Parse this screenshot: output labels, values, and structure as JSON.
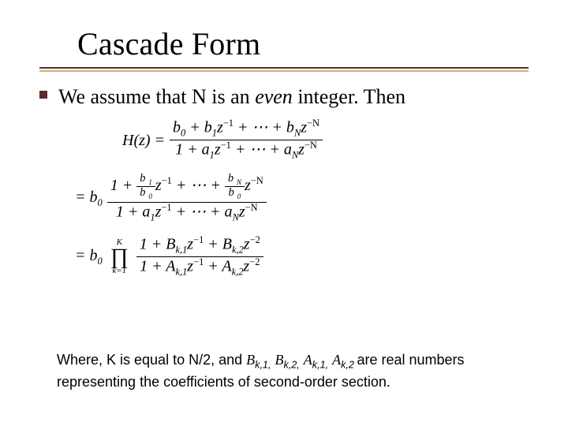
{
  "title": "Cascade Form",
  "lead": {
    "prefix": "We assume that N is an ",
    "even": "even",
    "suffix": " integer. Then"
  },
  "eq1": {
    "lhs": "H(z) =",
    "num": {
      "t0": "b",
      "s0": "0",
      "plus1": " + b",
      "s1": "1",
      "z1": "z",
      "e1": "−1",
      "plus2": " + ⋯ + b",
      "sN": "N",
      "zN": "z",
      "eN": "−N"
    },
    "den": {
      "one": "1 + a",
      "s1": "1",
      "z1": "z",
      "e1": "−1",
      "plus2": " + ⋯ + a",
      "sN": "N",
      "zN": "z",
      "eN": "−N"
    }
  },
  "eq2": {
    "eq": "= b",
    "b0sub": "0",
    "num": {
      "one": "1 + ",
      "f1n": "b",
      "f1ns": "1",
      "f1d": "b",
      "f1ds": "0",
      "z1": "z",
      "e1": "−1",
      "mid": " + ⋯ + ",
      "f2n": "b",
      "f2ns": "N",
      "f2d": "b",
      "f2ds": "0",
      "zN": "z",
      "eN": "−N"
    },
    "den": {
      "one": "1 + a",
      "s1": "1",
      "z1": "z",
      "e1": "−1",
      "plus2": " + ⋯ + a",
      "sN": "N",
      "zN": "z",
      "eN": "−N"
    }
  },
  "eq3": {
    "eq": "= b",
    "b0sub": "0",
    "prod": {
      "top": "K",
      "sym": "∏",
      "bot": "k=1"
    },
    "num": {
      "a": "1 + B",
      "s1": "k,1",
      "z1": "z",
      "e1": "−1",
      "b": " + B",
      "s2": "k,2",
      "z2": "z",
      "e2": "−2"
    },
    "den": {
      "a": "1 + A",
      "s1": "k,1",
      "z1": "z",
      "e1": "−1",
      "b": " + A",
      "s2": "k,2",
      "z2": "z",
      "e2": "−2"
    }
  },
  "footer": {
    "p1a": "Where, K is equal to N/2, and ",
    "B": "B",
    "s1": "k,1,",
    "sp1": " ",
    "B2": "B",
    "s2": "k,2,",
    "sp2": " ",
    "A": "A",
    "s3": "k,1,",
    "sp3": " ",
    "A2": "A",
    "s4": "k,2 ",
    "p1b": "are real numbers representing the coefficients of second-order section."
  }
}
